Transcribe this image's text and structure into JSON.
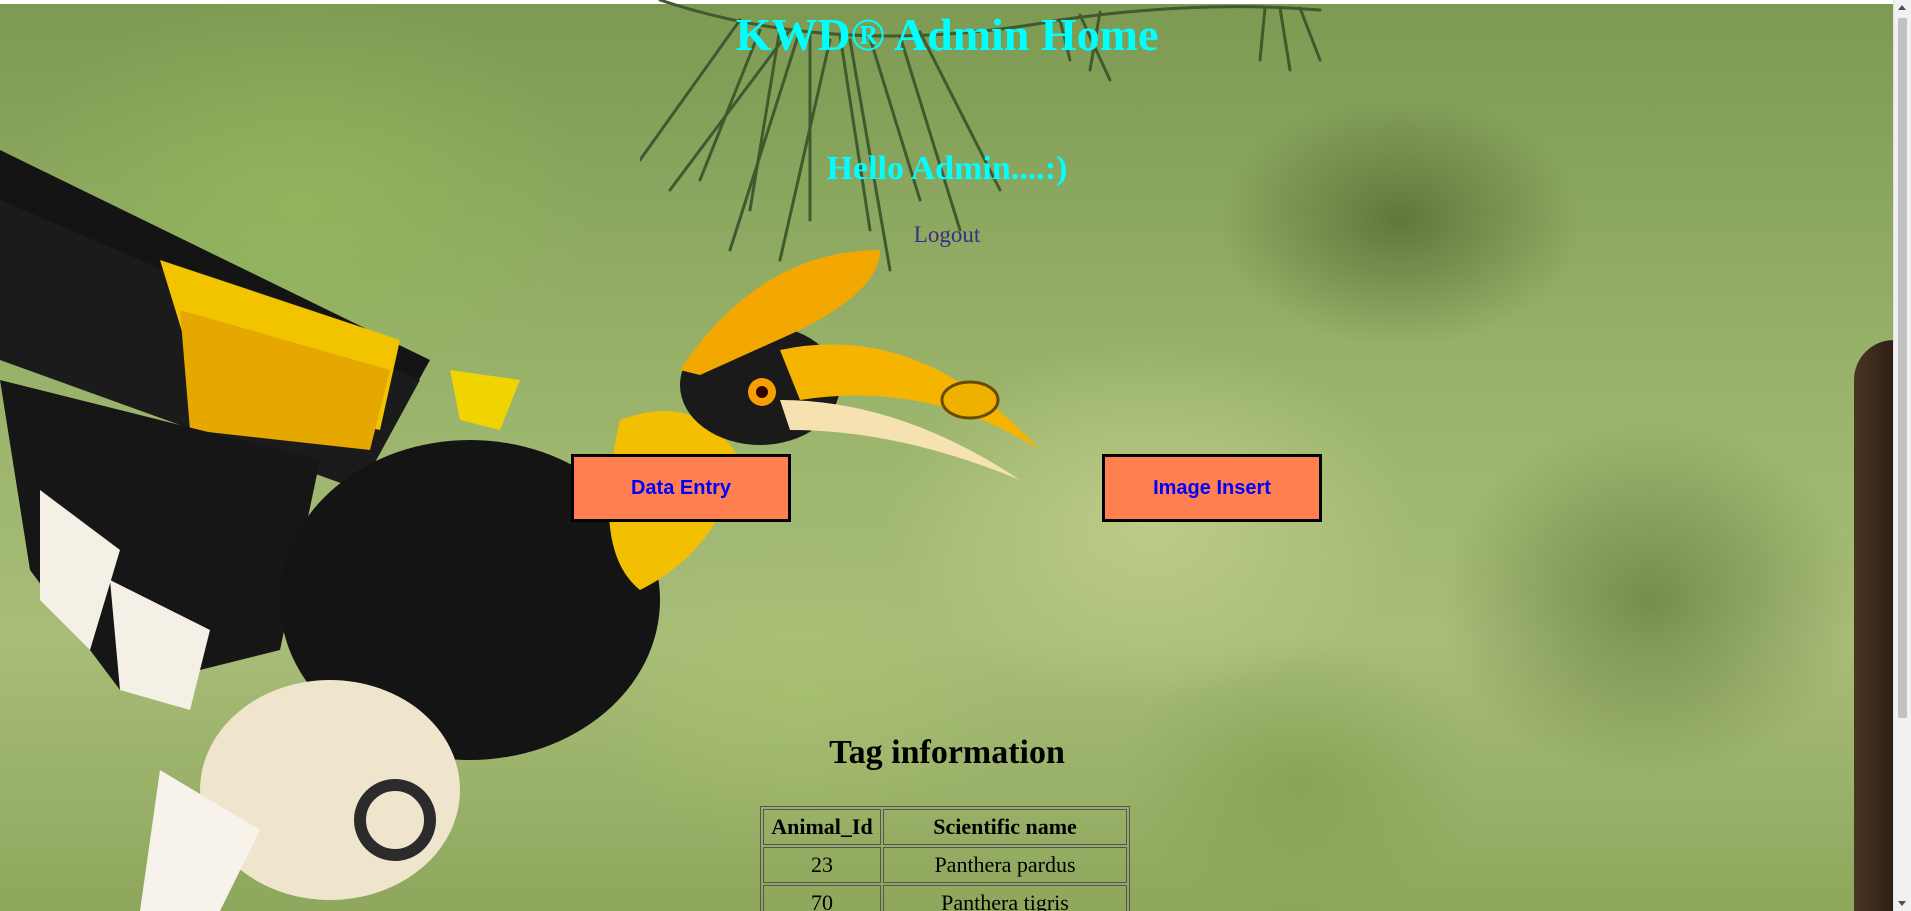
{
  "header": {
    "title": "KWD® Admin Home",
    "greeting": "Hello Admin....:)",
    "logout_label": "Logout"
  },
  "nav": {
    "data_entry_label": "Data Entry",
    "image_insert_label": "Image Insert"
  },
  "tag_section": {
    "heading": "Tag information",
    "columns": [
      "Animal_Id",
      "Scientific name"
    ],
    "rows": [
      {
        "animal_id": "23",
        "scientific_name": "Panthera pardus"
      },
      {
        "animal_id": "70",
        "scientific_name": "Panthera tigris"
      }
    ]
  },
  "colors": {
    "title": "#00ffff",
    "button_bg": "#ff7f50",
    "button_text": "#0000ff",
    "logout": "#3d2b86"
  },
  "background": {
    "icon": "hornbill-bird-illustration"
  }
}
